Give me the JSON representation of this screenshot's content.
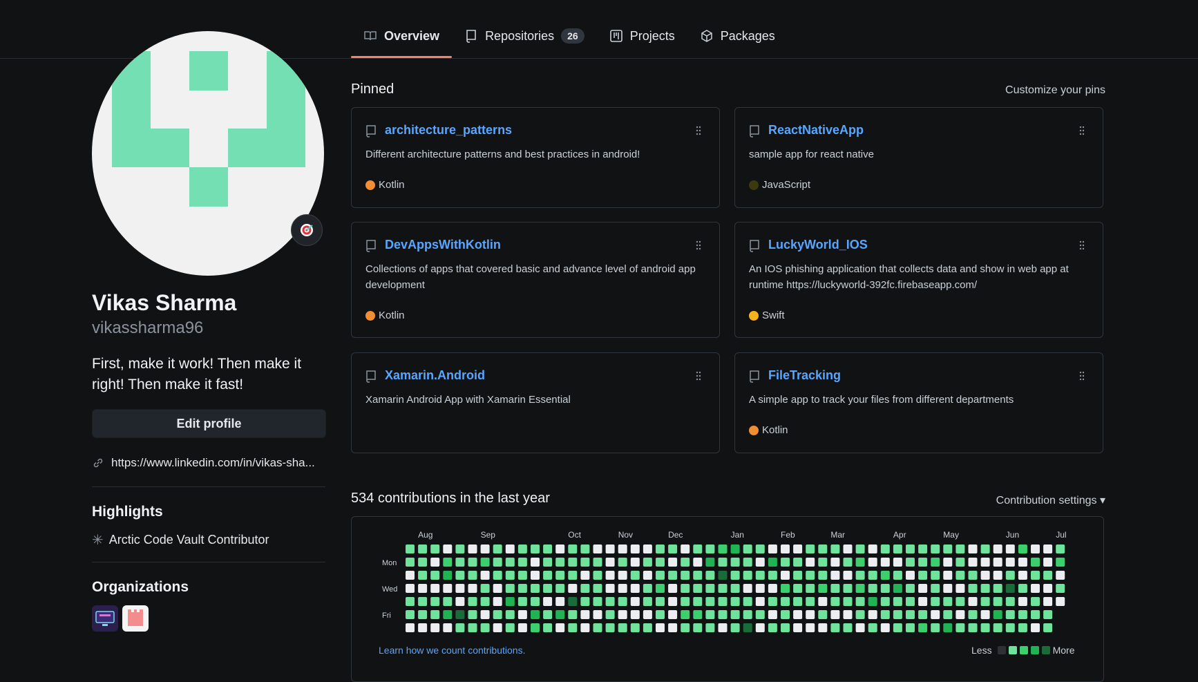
{
  "tabs": [
    {
      "label": "Overview",
      "icon": "book-icon",
      "active": true
    },
    {
      "label": "Repositories",
      "icon": "repo-icon",
      "count": "26"
    },
    {
      "label": "Projects",
      "icon": "project-icon"
    },
    {
      "label": "Packages",
      "icon": "package-icon"
    }
  ],
  "profile": {
    "full_name": "Vikas Sharma",
    "username": "vikassharma96",
    "bio": "First, make it work! Then make it right! Then make it fast!",
    "edit_label": "Edit profile",
    "link": "https://www.linkedin.com/in/vikas-sha...",
    "status_icon": "dart-target-icon"
  },
  "highlights": {
    "title": "Highlights",
    "items": [
      "Arctic Code Vault Contributor"
    ]
  },
  "organizations": {
    "title": "Organizations"
  },
  "pinned": {
    "title": "Pinned",
    "customize_label": "Customize your pins",
    "repos": [
      {
        "name": "architecture_patterns",
        "desc": "Different architecture patterns and best practices in android!",
        "lang": "Kotlin",
        "color": "#f18e33"
      },
      {
        "name": "ReactNativeApp",
        "desc": "sample app for react native",
        "lang": "JavaScript",
        "color": "#3b3a0e"
      },
      {
        "name": "DevAppsWithKotlin",
        "desc": "Collections of apps that covered basic and advance level of android app development",
        "lang": "Kotlin",
        "color": "#f18e33"
      },
      {
        "name": "LuckyWorld_IOS",
        "desc": "An IOS phishing application that collects data and show in web app at runtime https://luckyworld-392fc.firebaseapp.com/",
        "lang": "Swift",
        "color": "#f7b21b"
      },
      {
        "name": "Xamarin.Android",
        "desc": "Xamarin Android App with Xamarin Essential",
        "lang": ""
      },
      {
        "name": "FileTracking",
        "desc": "A simple app to track your files from different departments",
        "lang": "Kotlin",
        "color": "#f18e33"
      }
    ]
  },
  "contributions": {
    "title": "534 contributions in the last year",
    "settings_label": "Contribution settings ▾",
    "months": [
      "Aug",
      "Sep",
      "Oct",
      "Nov",
      "Dec",
      "Jan",
      "Feb",
      "Mar",
      "Apr",
      "May",
      "Jun",
      "Jul"
    ],
    "days": [
      "Mon",
      "Wed",
      "Fri"
    ],
    "learn_label": "Learn how we count contributions.",
    "less_label": "Less",
    "more_label": "More",
    "level_colors": [
      "#ebedf0",
      "#6fe29b",
      "#3bcf6e",
      "#1fb354",
      "#1a6b3a"
    ]
  }
}
